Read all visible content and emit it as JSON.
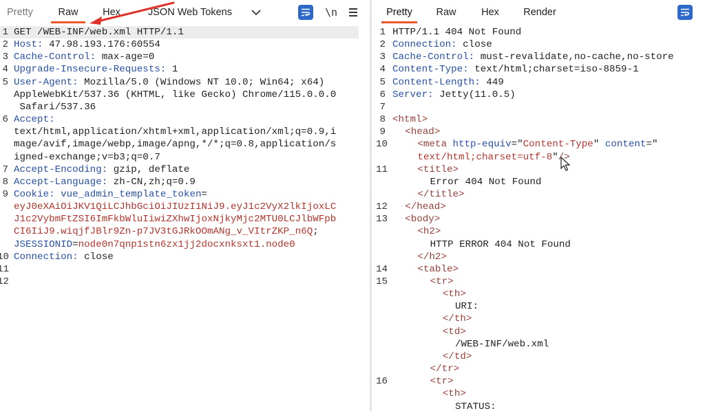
{
  "left": {
    "tabs": [
      {
        "label": "Pretty"
      },
      {
        "label": "Raw"
      },
      {
        "label": "Hex"
      },
      {
        "label": "JSON Web Tokens"
      }
    ],
    "newline_toggle": "\\n",
    "lines": [
      {
        "n": "1",
        "parts": [
          {
            "t": "GET /WEB-INF/web.xml HTTP/1.1",
            "c": "plain"
          }
        ]
      },
      {
        "n": "2",
        "parts": [
          {
            "t": "Host:",
            "c": "key"
          },
          {
            "t": " 47.98.193.176:60554",
            "c": "plain"
          }
        ]
      },
      {
        "n": "3",
        "parts": [
          {
            "t": "Cache-Control:",
            "c": "key"
          },
          {
            "t": " max-age=0",
            "c": "plain"
          }
        ]
      },
      {
        "n": "4",
        "parts": [
          {
            "t": "Upgrade-Insecure-Requests:",
            "c": "key"
          },
          {
            "t": " 1",
            "c": "plain"
          }
        ]
      },
      {
        "n": "5",
        "parts": [
          {
            "t": "User-Agent:",
            "c": "key"
          },
          {
            "t": " Mozilla/5.0 (Windows NT 10.0; Win64; x64)",
            "c": "plain"
          }
        ]
      },
      {
        "n": "",
        "parts": [
          {
            "t": "AppleWebKit/537.36 (KHTML, like Gecko) Chrome/115.0.0.0",
            "c": "plain"
          }
        ]
      },
      {
        "n": "",
        "parts": [
          {
            "t": " Safari/537.36",
            "c": "plain"
          }
        ]
      },
      {
        "n": "6",
        "parts": [
          {
            "t": "Accept:",
            "c": "key"
          }
        ]
      },
      {
        "n": "",
        "parts": [
          {
            "t": "text/html,application/xhtml+xml,application/xml;q=0.9,i",
            "c": "plain"
          }
        ]
      },
      {
        "n": "",
        "parts": [
          {
            "t": "mage/avif,image/webp,image/apng,*/*;q=0.8,application/s",
            "c": "plain"
          }
        ]
      },
      {
        "n": "",
        "parts": [
          {
            "t": "igned-exchange;v=b3;q=0.7",
            "c": "plain"
          }
        ]
      },
      {
        "n": "7",
        "parts": [
          {
            "t": "Accept-Encoding:",
            "c": "key"
          },
          {
            "t": " gzip, deflate",
            "c": "plain"
          }
        ]
      },
      {
        "n": "8",
        "parts": [
          {
            "t": "Accept-Language:",
            "c": "key"
          },
          {
            "t": " zh-CN,zh;q=0.9",
            "c": "plain"
          }
        ]
      },
      {
        "n": "9",
        "parts": [
          {
            "t": "Cookie:",
            "c": "key"
          },
          {
            "t": " vue_admin_template_token",
            "c": "key"
          },
          {
            "t": "=",
            "c": "plain"
          }
        ]
      },
      {
        "n": "",
        "parts": [
          {
            "t": "eyJ0eXAiOiJKV1QiLCJhbGciOiJIUzI1NiJ9.eyJ1c2VyX2lkIjoxLC",
            "c": "ckv"
          }
        ]
      },
      {
        "n": "",
        "parts": [
          {
            "t": "J1c2VybmFtZSI6ImFkbWluIiwiZXhwIjoxNjkyMjc2MTU0LCJlbWFpb",
            "c": "ckv"
          }
        ]
      },
      {
        "n": "",
        "parts": [
          {
            "t": "CI6IiJ9.wiqjfJBlr9Zn-p7JV3tGJRkOOmANg_v_VItrZKP_n6Q",
            "c": "ckv"
          },
          {
            "t": ";",
            "c": "plain"
          }
        ]
      },
      {
        "n": "",
        "parts": [
          {
            "t": "JSESSIONID",
            "c": "key"
          },
          {
            "t": "=",
            "c": "plain"
          },
          {
            "t": "node0n7qnp1stn6zx1jj2docxnksxt1.node0",
            "c": "ckv"
          }
        ]
      },
      {
        "n": "10",
        "parts": [
          {
            "t": "Connection:",
            "c": "key"
          },
          {
            "t": " close",
            "c": "plain"
          }
        ]
      },
      {
        "n": "11",
        "parts": []
      },
      {
        "n": "12",
        "parts": []
      }
    ]
  },
  "right": {
    "tabs": [
      {
        "label": "Pretty"
      },
      {
        "label": "Raw"
      },
      {
        "label": "Hex"
      },
      {
        "label": "Render"
      }
    ],
    "lines": [
      {
        "n": "1",
        "i": 0,
        "parts": [
          {
            "t": "HTTP/1.1 404 Not Found",
            "c": "plain"
          }
        ]
      },
      {
        "n": "2",
        "i": 0,
        "parts": [
          {
            "t": "Connection:",
            "c": "key"
          },
          {
            "t": " close",
            "c": "plain"
          }
        ]
      },
      {
        "n": "3",
        "i": 0,
        "parts": [
          {
            "t": "Cache-Control:",
            "c": "key"
          },
          {
            "t": " must-revalidate,no-cache,no-store",
            "c": "plain"
          }
        ]
      },
      {
        "n": "4",
        "i": 0,
        "parts": [
          {
            "t": "Content-Type:",
            "c": "key"
          },
          {
            "t": " text/html;charset=iso-8859-1",
            "c": "plain"
          }
        ]
      },
      {
        "n": "5",
        "i": 0,
        "parts": [
          {
            "t": "Content-Length:",
            "c": "key"
          },
          {
            "t": " 449",
            "c": "plain"
          }
        ]
      },
      {
        "n": "6",
        "i": 0,
        "parts": [
          {
            "t": "Server:",
            "c": "key"
          },
          {
            "t": " Jetty(11.0.5)",
            "c": "plain"
          }
        ]
      },
      {
        "n": "7",
        "i": 0,
        "parts": []
      },
      {
        "n": "8",
        "i": 0,
        "parts": [
          {
            "t": "<html>",
            "c": "tag"
          }
        ]
      },
      {
        "n": "9",
        "i": 1,
        "parts": [
          {
            "t": "<head>",
            "c": "tag"
          }
        ]
      },
      {
        "n": "10",
        "i": 2,
        "parts": [
          {
            "t": "<meta ",
            "c": "tag"
          },
          {
            "t": "http-equiv",
            "c": "attr"
          },
          {
            "t": "=\"",
            "c": "plain"
          },
          {
            "t": "Content-Type",
            "c": "aval"
          },
          {
            "t": "\" ",
            "c": "plain"
          },
          {
            "t": "content",
            "c": "attr"
          },
          {
            "t": "=\"",
            "c": "plain"
          }
        ]
      },
      {
        "n": "",
        "i": 2,
        "parts": [
          {
            "t": "text/html;charset=utf-8",
            "c": "aval"
          },
          {
            "t": "\"",
            "c": "plain"
          },
          {
            "t": "/>",
            "c": "tag"
          }
        ]
      },
      {
        "n": "11",
        "i": 2,
        "parts": [
          {
            "t": "<title>",
            "c": "tag"
          }
        ]
      },
      {
        "n": "",
        "i": 3,
        "parts": [
          {
            "t": "Error 404 Not Found",
            "c": "plain"
          }
        ]
      },
      {
        "n": "",
        "i": 2,
        "parts": [
          {
            "t": "</title>",
            "c": "tag"
          }
        ]
      },
      {
        "n": "12",
        "i": 1,
        "parts": [
          {
            "t": "</head>",
            "c": "tag"
          }
        ]
      },
      {
        "n": "13",
        "i": 1,
        "parts": [
          {
            "t": "<body>",
            "c": "tag"
          }
        ]
      },
      {
        "n": "",
        "i": 2,
        "parts": [
          {
            "t": "<h2>",
            "c": "tag"
          }
        ]
      },
      {
        "n": "",
        "i": 3,
        "parts": [
          {
            "t": "HTTP ERROR 404 Not Found",
            "c": "plain"
          }
        ]
      },
      {
        "n": "",
        "i": 2,
        "parts": [
          {
            "t": "</h2>",
            "c": "tag"
          }
        ]
      },
      {
        "n": "14",
        "i": 2,
        "parts": [
          {
            "t": "<table>",
            "c": "tag"
          }
        ]
      },
      {
        "n": "15",
        "i": 3,
        "parts": [
          {
            "t": "<tr>",
            "c": "tag"
          }
        ]
      },
      {
        "n": "",
        "i": 4,
        "parts": [
          {
            "t": "<th>",
            "c": "tag"
          }
        ]
      },
      {
        "n": "",
        "i": 5,
        "parts": [
          {
            "t": "URI:",
            "c": "plain"
          }
        ]
      },
      {
        "n": "",
        "i": 4,
        "parts": [
          {
            "t": "</th>",
            "c": "tag"
          }
        ]
      },
      {
        "n": "",
        "i": 4,
        "parts": [
          {
            "t": "<td>",
            "c": "tag"
          }
        ]
      },
      {
        "n": "",
        "i": 5,
        "parts": [
          {
            "t": "/WEB-INF/web.xml",
            "c": "plain"
          }
        ]
      },
      {
        "n": "",
        "i": 4,
        "parts": [
          {
            "t": "</td>",
            "c": "tag"
          }
        ]
      },
      {
        "n": "",
        "i": 3,
        "parts": [
          {
            "t": "</tr>",
            "c": "tag"
          }
        ]
      },
      {
        "n": "16",
        "i": 3,
        "parts": [
          {
            "t": "<tr>",
            "c": "tag"
          }
        ]
      },
      {
        "n": "",
        "i": 4,
        "parts": [
          {
            "t": "<th>",
            "c": "tag"
          }
        ]
      },
      {
        "n": "",
        "i": 5,
        "parts": [
          {
            "t": "STATUS:",
            "c": "plain"
          }
        ]
      }
    ]
  },
  "icons": {
    "format": "format-lines-icon",
    "menu": "hamburger-menu-icon",
    "dropdown": "chevron-down-icon",
    "arrow": "red-arrow-annotation",
    "cursor": "mouse-pointer-icon"
  },
  "colors": {
    "active_tab_underline": "#e8582a",
    "header_key": "#2850a8",
    "value_red": "#b5352e",
    "tag": "#98403a",
    "format_button": "#2e68c9",
    "arrow": "#e0322a"
  }
}
